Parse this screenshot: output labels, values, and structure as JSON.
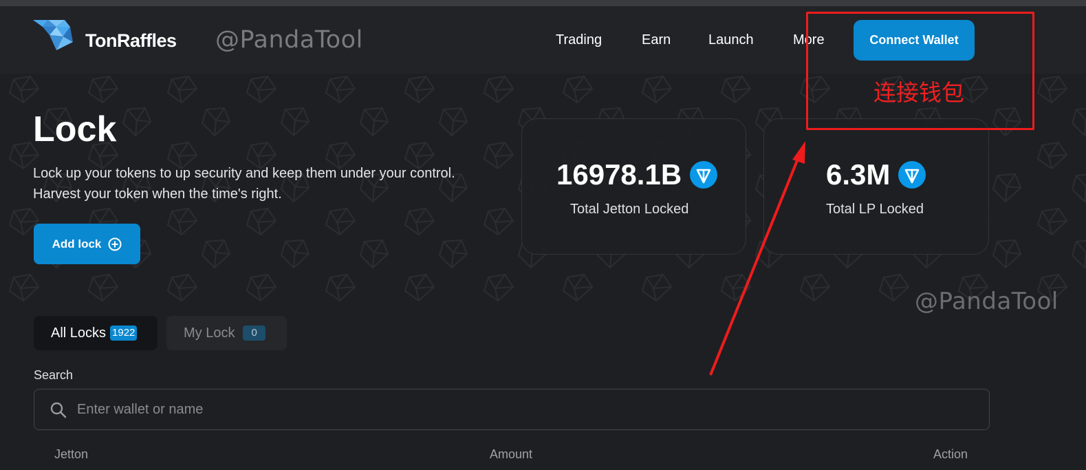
{
  "header": {
    "brand": "TonRaffles",
    "watermark": "@PandaTool",
    "nav": [
      "Trading",
      "Earn",
      "Launch",
      "More"
    ],
    "connect_wallet": "Connect Wallet"
  },
  "lock": {
    "title": "Lock",
    "description_line1": "Lock up your tokens to up security and keep them under your control.",
    "description_line2": "Harvest your token when the time's right.",
    "add_lock": "Add lock"
  },
  "stats": [
    {
      "value": "16978.1B",
      "label": "Total Jetton Locked",
      "icon": "ton-icon"
    },
    {
      "value": "6.3M",
      "label": "Total LP Locked",
      "icon": "ton-icon"
    }
  ],
  "tabs": [
    {
      "label": "All Locks",
      "count": "1922"
    },
    {
      "label": "My Lock",
      "count": "0"
    }
  ],
  "search": {
    "label": "Search",
    "placeholder": "Enter wallet or name"
  },
  "table": {
    "columns": [
      "Jetton",
      "Amount",
      "Action"
    ]
  },
  "annotation": {
    "text": "连接钱包",
    "watermark2": "@PandaTool",
    "color": "#ee1c1c"
  },
  "colors": {
    "accent": "#0a88d0",
    "background": "#1e1f23"
  }
}
